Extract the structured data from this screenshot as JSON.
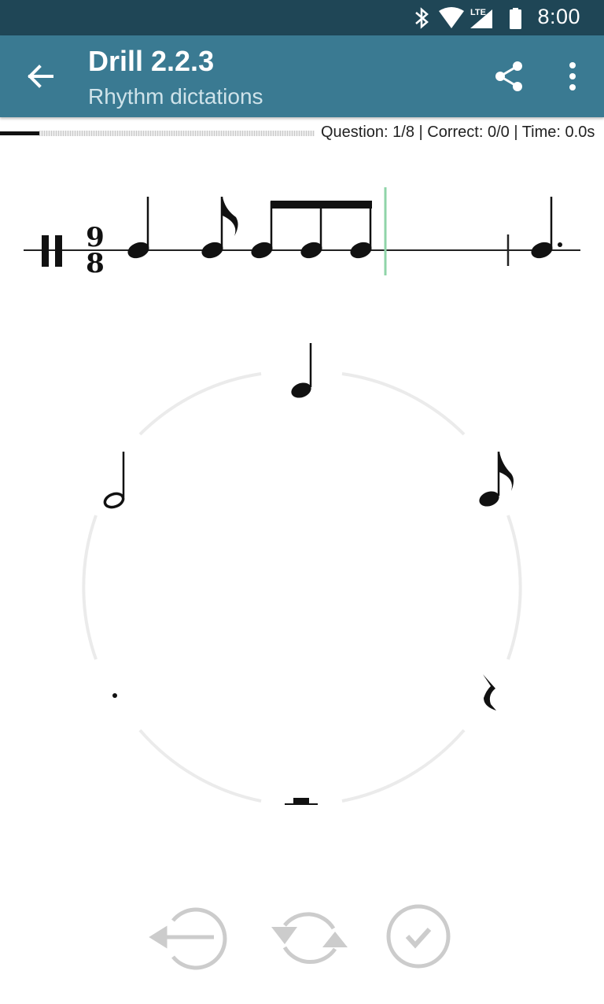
{
  "status": {
    "time": "8:00",
    "network": "LTE",
    "icons": [
      "bluetooth-icon",
      "wifi-icon",
      "lte-signal-icon",
      "battery-icon"
    ]
  },
  "appbar": {
    "title": "Drill 2.2.3",
    "subtitle": "Rhythm dictations",
    "icons": [
      "back-arrow-icon",
      "share-icon",
      "more-vert-icon"
    ]
  },
  "progress": {
    "fraction": 0.125,
    "stats": "Question: 1/8 | Correct: 0/0 | Time: 0.0s"
  },
  "staff": {
    "time_signature": {
      "top": "9",
      "bottom": "8"
    },
    "notes": [
      "quarter",
      "eighth",
      "eighth-beamed",
      "eighth-beamed",
      "eighth-beamed",
      "dotted-quarter"
    ]
  },
  "wheel": {
    "options": [
      "quarter-note",
      "eighth-note",
      "eighth-rest",
      "whole-rest",
      "dot",
      "half-note"
    ]
  },
  "controls": [
    "backspace-icon",
    "replay-icon",
    "check-icon"
  ],
  "colors": {
    "status_bar": "#1f4656",
    "app_bar": "#3a7a92",
    "cursor": "#8fd4a8",
    "disabled": "#cccccc"
  }
}
